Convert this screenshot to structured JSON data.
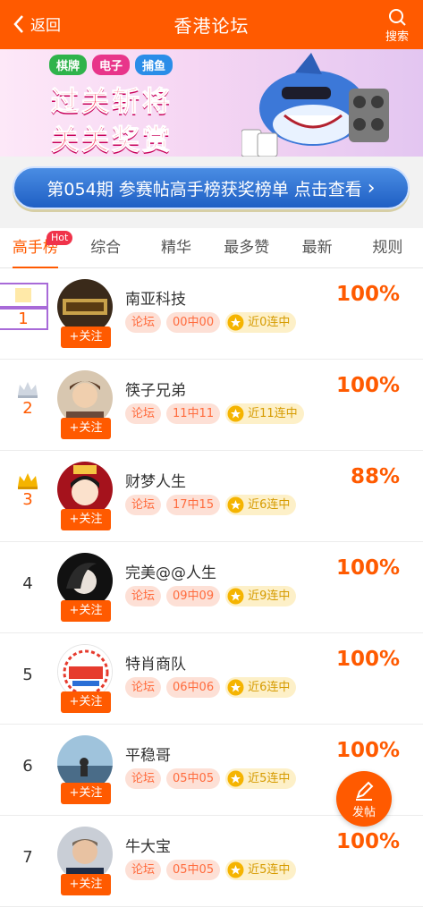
{
  "header": {
    "back_label": "返回",
    "title": "香港论坛",
    "search_label": "搜索"
  },
  "banner": {
    "tags": [
      "棋牌",
      "电子",
      "捕鱼"
    ],
    "slogan_line1": "过关斩将",
    "slogan_line2": "关关奖赏"
  },
  "notice": {
    "text": "第054期 参赛帖高手榜获奖榜单 点击查看",
    "chevron": "›"
  },
  "tabs": [
    {
      "label": "高手榜",
      "active": true,
      "badge": "Hot"
    },
    {
      "label": "综合"
    },
    {
      "label": "精华"
    },
    {
      "label": "最多赞"
    },
    {
      "label": "最新"
    },
    {
      "label": "规则"
    }
  ],
  "follow_label": "+关注",
  "forum_label": "论坛",
  "rankings": [
    {
      "rank": "1",
      "name": "南亚科技",
      "record": "00中00",
      "streak": "近0连中",
      "rate": "100%"
    },
    {
      "rank": "2",
      "name": "筷子兄弟",
      "record": "11中11",
      "streak": "近11连中",
      "rate": "100%"
    },
    {
      "rank": "3",
      "name": "财梦人生",
      "record": "17中15",
      "streak": "近6连中",
      "rate": "88%"
    },
    {
      "rank": "4",
      "name": "完美@@人生",
      "record": "09中09",
      "streak": "近9连中",
      "rate": "100%"
    },
    {
      "rank": "5",
      "name": "特肖商队",
      "record": "06中06",
      "streak": "近6连中",
      "rate": "100%"
    },
    {
      "rank": "6",
      "name": "平稳哥",
      "record": "05中05",
      "streak": "近5连中",
      "rate": "100%"
    },
    {
      "rank": "7",
      "name": "牛大宝",
      "record": "05中05",
      "streak": "近5连中",
      "rate": "100%"
    }
  ],
  "post_button": {
    "label": "发帖"
  },
  "colors": {
    "primary": "#ff5a00",
    "gold": "#f5b400"
  }
}
